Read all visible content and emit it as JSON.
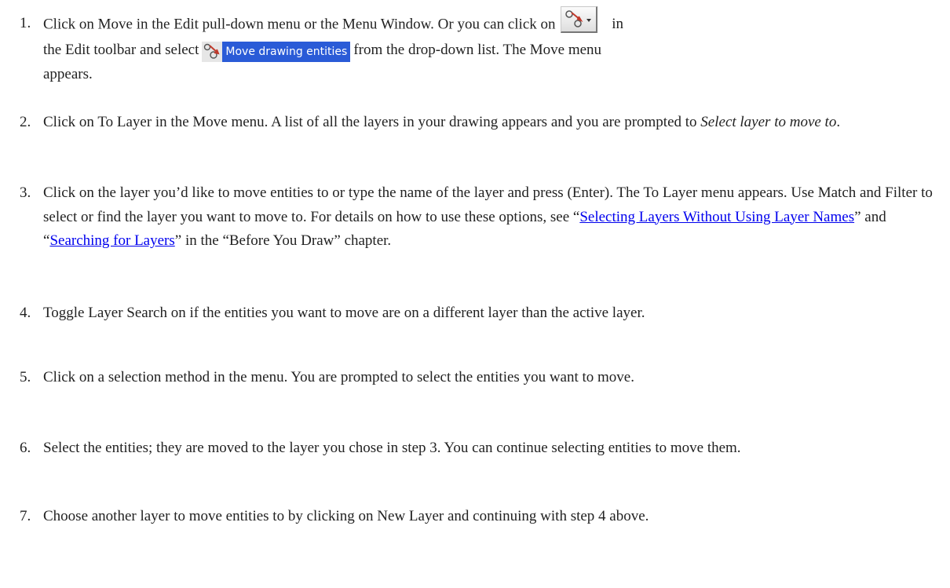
{
  "steps": [
    {
      "number": "1.",
      "line1_a": "Click on Move in the Edit pull-down menu or the Menu Window. Or you can click on",
      "line1_b": "in",
      "line2_a": "the Edit toolbar and select",
      "menu_item_label": "Move drawing entities",
      "line2_b": "from the drop-down list. The Move menu",
      "line3": "appears."
    },
    {
      "number": "2.",
      "text_a": "Click on To Layer in the Move menu. A list of all the layers in your drawing appears and you are prompted to",
      "emphasis": "Select layer to move to",
      "text_b": "."
    },
    {
      "number": "3.",
      "text_a": "Click on the layer you’d like to move entities to or type the name of the layer and press (Enter). The To Layer menu appears. Use Match and Filter to select or find the layer you want to move to. For details on how to use these options, see “",
      "link1": "Selecting Layers Without Using Layer Names",
      "text_b": "” and “",
      "link2": "Searching for Layers",
      "text_c": "” in the “Before You Draw” chapter."
    },
    {
      "number": "4.",
      "text": "Toggle Layer Search on if the entities you want to move are on a different layer than the active layer."
    },
    {
      "number": "5.",
      "text": "Click on a selection method in the menu. You are prompted to select the entities you want to move."
    },
    {
      "number": "6.",
      "text": "Select the entities; they are moved to the layer you chose in step 3. You can continue selecting entities to move them."
    },
    {
      "number": "7.",
      "text": "Choose another layer to move entities to by clicking on New Layer and continuing with step 4 above."
    }
  ],
  "icons": {
    "toolbar_button": "move-entities-dropdown-icon",
    "menu_item_icon": "move-entities-icon"
  },
  "colors": {
    "link": "#0000ee",
    "menu_highlight": "#2a5bd7",
    "text": "#222222"
  }
}
